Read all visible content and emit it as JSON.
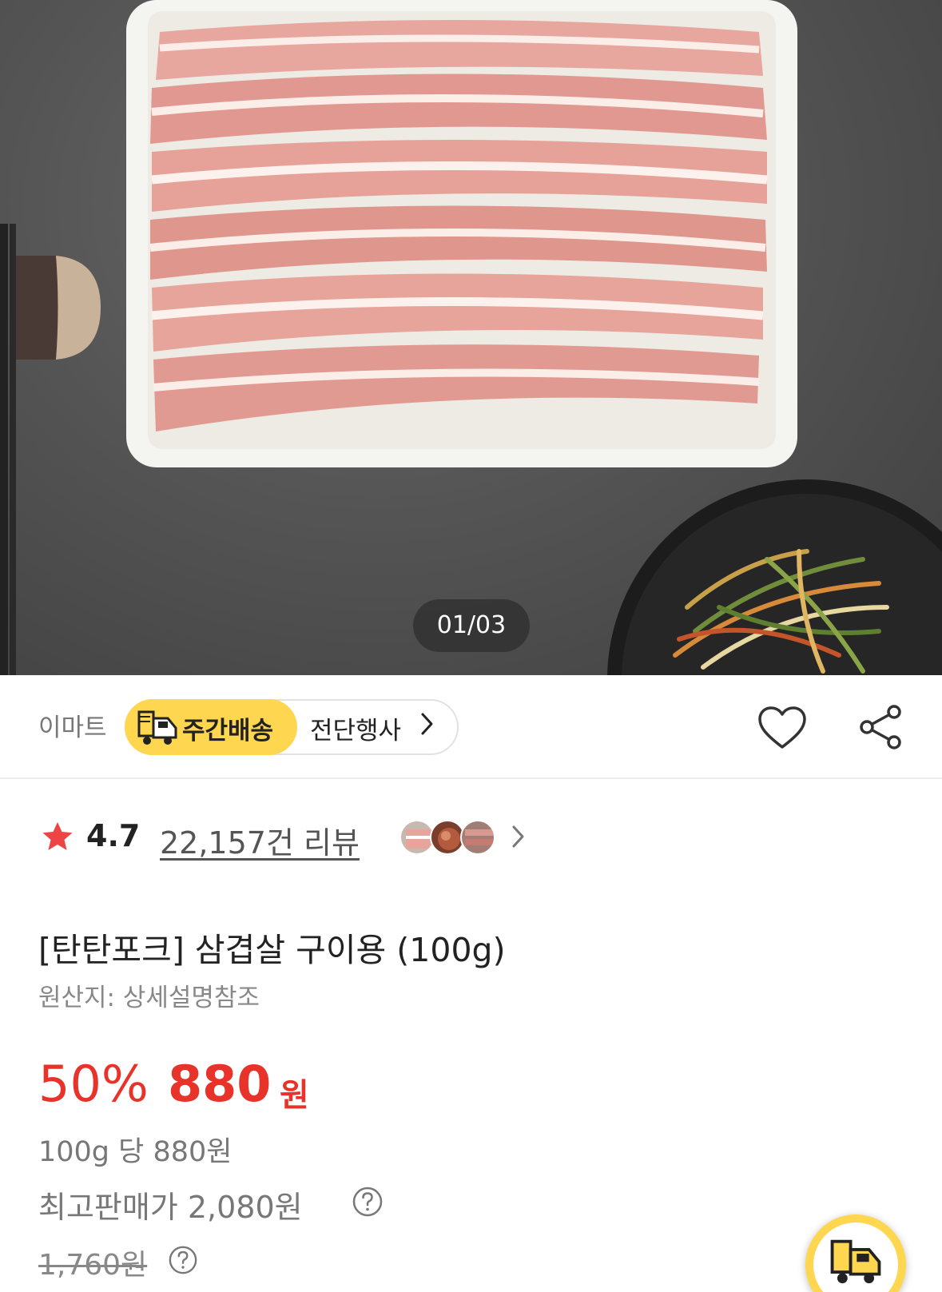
{
  "gallery": {
    "counter": "01/03"
  },
  "seller": {
    "name": "이마트",
    "delivery_label": "주간배송",
    "event_label": "전단행사"
  },
  "icons": {
    "delivery": "truck-icon",
    "event_chevron": "chevron-right-icon",
    "wishlist": "heart-icon",
    "share": "share-icon",
    "rating": "star-icon",
    "review_chevron": "chevron-right-icon",
    "help": "question-circle-icon",
    "floating": "truck-icon"
  },
  "rating": {
    "score": "4.7",
    "review_count": "22,157건 리뷰"
  },
  "product": {
    "title": "[탄탄포크] 삼겹살 구이용 (100g)",
    "origin": "원산지: 상세설명참조"
  },
  "pricing": {
    "discount": "50%",
    "price": "880",
    "currency": "원",
    "unit_price": "100g 당 880원",
    "max_price": "최고판매가 2,080원",
    "original_price": "1,760원"
  },
  "colors": {
    "accent_red": "#e8332b",
    "delivery_yellow": "#ffd64f"
  }
}
